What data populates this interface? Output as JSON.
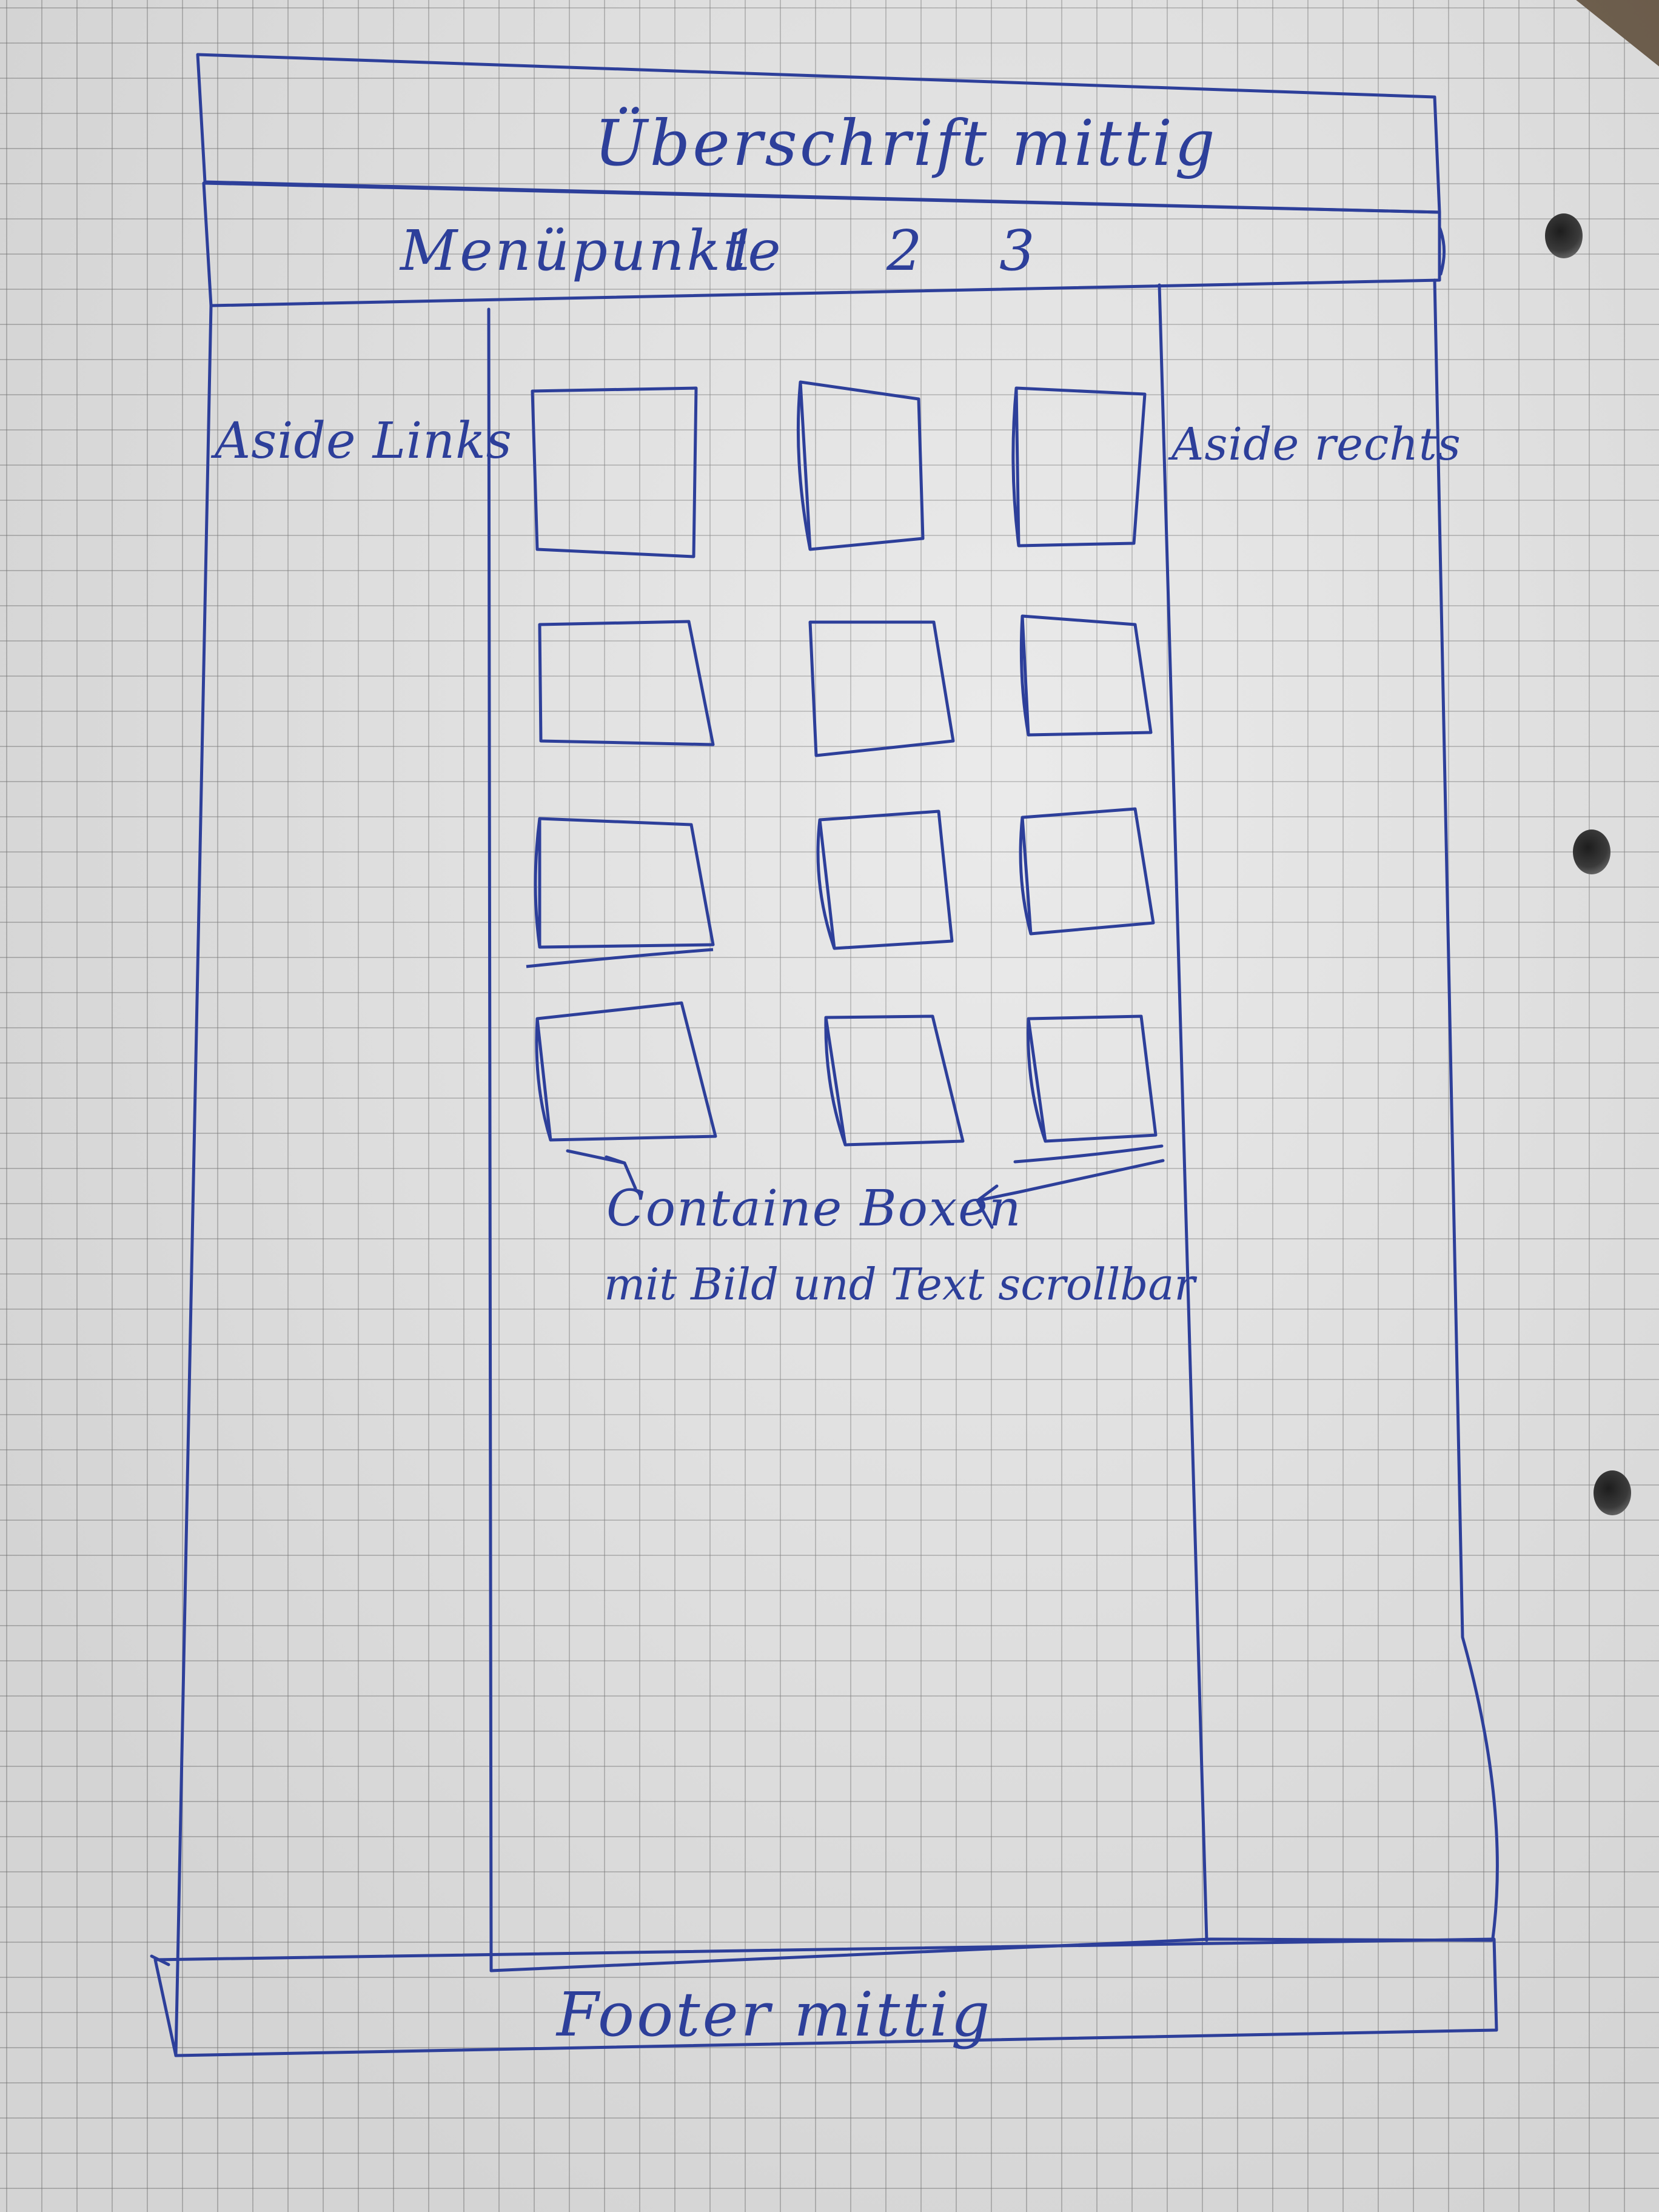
{
  "header": {
    "title": "Überschrift mittig",
    "menu_label": "Menüpunkte",
    "menu_items": [
      "1",
      "2",
      "3"
    ]
  },
  "sidebar_left": {
    "label": "Aside Links"
  },
  "sidebar_right": {
    "label": "Aside rechts"
  },
  "main": {
    "grid_rows": 4,
    "grid_columns": 3,
    "note_line1": "Containe Boxen",
    "note_line2": "mit Bild und Text scrollbar"
  },
  "footer": {
    "label": "Footer mittig"
  },
  "colors": {
    "ink": "#2d3f9a",
    "paper": "#e6e6e6",
    "grid": "#8a8a8a"
  }
}
